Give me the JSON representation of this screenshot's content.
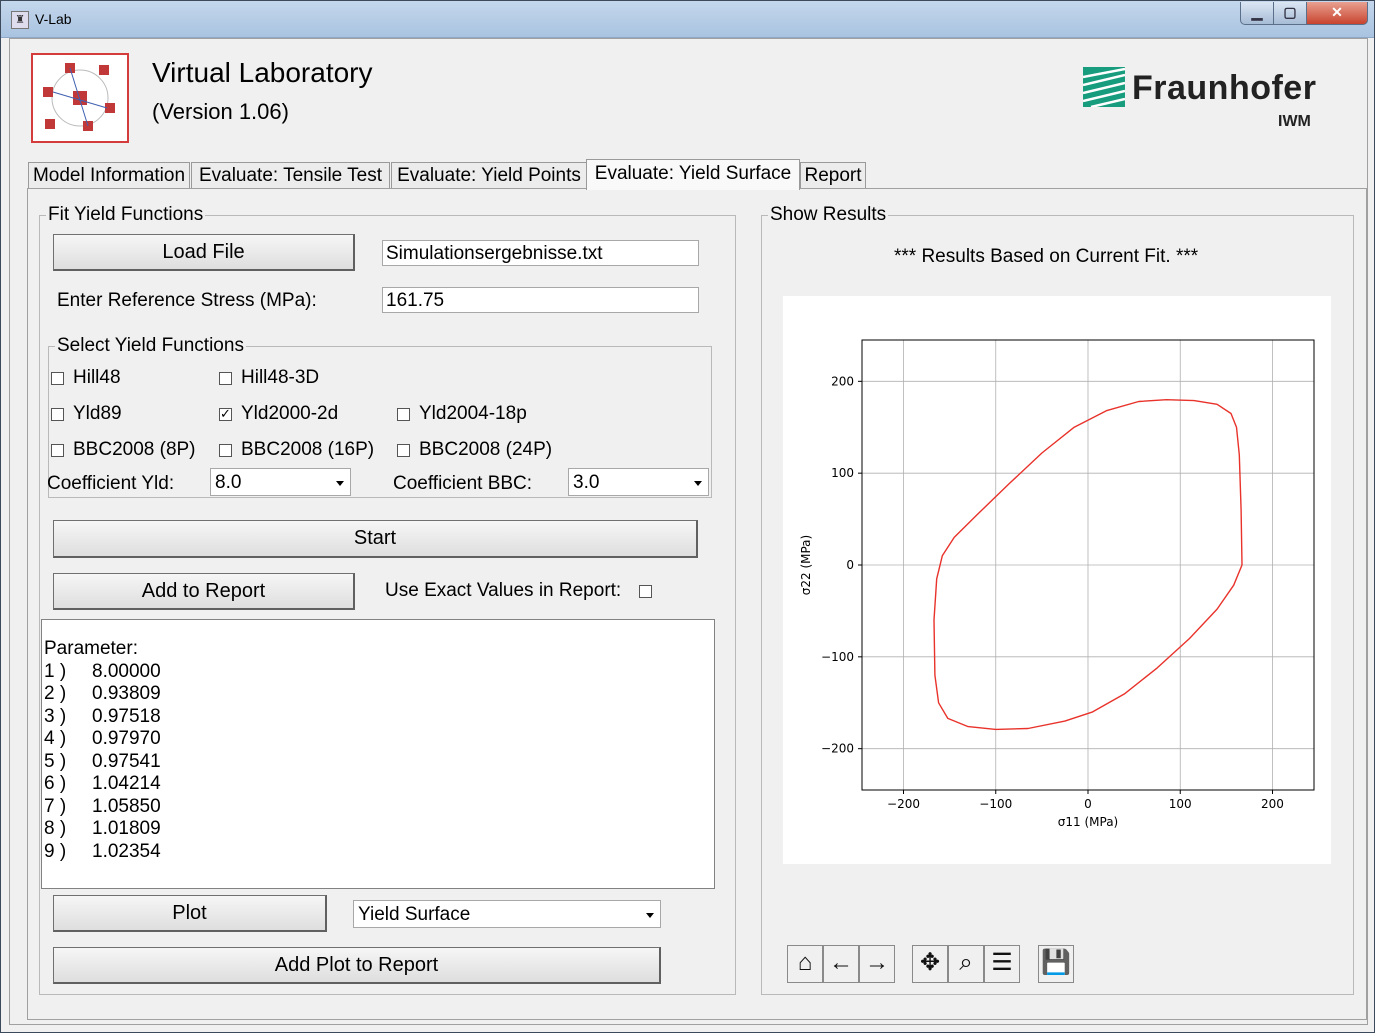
{
  "window": {
    "title": "V-Lab"
  },
  "header": {
    "app_title": "Virtual Laboratory",
    "app_version": "(Version 1.06)",
    "brand_name": "Fraunhofer",
    "brand_sub": "IWM",
    "brand_color": "#179c7d"
  },
  "tabs": [
    {
      "label": "Model Information"
    },
    {
      "label": "Evaluate: Tensile Test"
    },
    {
      "label": "Evaluate: Yield Points"
    },
    {
      "label": "Evaluate: Yield Surface"
    },
    {
      "label": "Report"
    }
  ],
  "active_tab": "Evaluate: Yield Surface",
  "fit": {
    "group_title": "Fit Yield Functions",
    "load_file_label": "Load File",
    "file_value": "Simulationsergebnisse.txt",
    "ref_stress_label": "Enter Reference Stress (MPa):",
    "ref_stress_value": "161.75",
    "select_group_title": "Select Yield Functions",
    "functions": {
      "hill48": {
        "label": "Hill48",
        "checked": false
      },
      "hill48_3d": {
        "label": "Hill48-3D",
        "checked": false
      },
      "yld89": {
        "label": "Yld89",
        "checked": false
      },
      "yld2000": {
        "label": "Yld2000-2d",
        "checked": true
      },
      "yld2004": {
        "label": "Yld2004-18p",
        "checked": false
      },
      "bbc8": {
        "label": "BBC2008 (8P)",
        "checked": false
      },
      "bbc16": {
        "label": "BBC2008 (16P)",
        "checked": false
      },
      "bbc24": {
        "label": "BBC2008 (24P)",
        "checked": false
      }
    },
    "coef_yld_label": "Coefficient Yld:",
    "coef_yld_value": "8.0",
    "coef_bbc_label": "Coefficient BBC:",
    "coef_bbc_value": "3.0",
    "start_label": "Start",
    "add_report_label": "Add to Report",
    "exact_values_label": "Use Exact Values in Report:",
    "exact_values_checked": false,
    "output_heading": "Parameter:",
    "parameters": [
      {
        "idx": "1 )",
        "value": "8.00000"
      },
      {
        "idx": "2 )",
        "value": "0.93809"
      },
      {
        "idx": "3 )",
        "value": "0.97518"
      },
      {
        "idx": "4 )",
        "value": "0.97970"
      },
      {
        "idx": "5 )",
        "value": "0.97541"
      },
      {
        "idx": "6 )",
        "value": "1.04214"
      },
      {
        "idx": "7 )",
        "value": "1.05850"
      },
      {
        "idx": "8 )",
        "value": "1.01809"
      },
      {
        "idx": "9 )",
        "value": "1.02354"
      }
    ],
    "plot_label": "Plot",
    "plot_type_value": "Yield Surface",
    "add_plot_label": "Add Plot to Report"
  },
  "results": {
    "group_title": "Show Results",
    "caption": "*** Results Based on Current Fit. ***"
  },
  "chart_data": {
    "type": "line",
    "title": "",
    "xlabel": "σ11 (MPa)",
    "ylabel": "σ22 (MPa)",
    "xlim": [
      -245,
      245
    ],
    "ylim": [
      -245,
      245
    ],
    "xticks": [
      -200,
      -100,
      0,
      100,
      200
    ],
    "yticks": [
      -200,
      -100,
      0,
      100,
      200
    ],
    "grid": true,
    "series": [
      {
        "color": "#e8322a",
        "points": [
          [
            167,
            0
          ],
          [
            166,
            60
          ],
          [
            164,
            120
          ],
          [
            161,
            150
          ],
          [
            155,
            165
          ],
          [
            140,
            175
          ],
          [
            115,
            179
          ],
          [
            85,
            180
          ],
          [
            55,
            178
          ],
          [
            20,
            168
          ],
          [
            -15,
            150
          ],
          [
            -50,
            122
          ],
          [
            -85,
            89
          ],
          [
            -120,
            55
          ],
          [
            -145,
            30
          ],
          [
            -158,
            10
          ],
          [
            -164,
            -15
          ],
          [
            -167,
            -60
          ],
          [
            -166,
            -120
          ],
          [
            -162,
            -150
          ],
          [
            -152,
            -167
          ],
          [
            -130,
            -176
          ],
          [
            -100,
            -179
          ],
          [
            -65,
            -178
          ],
          [
            -25,
            -170
          ],
          [
            5,
            -160
          ],
          [
            40,
            -140
          ],
          [
            75,
            -112
          ],
          [
            110,
            -80
          ],
          [
            140,
            -48
          ],
          [
            158,
            -22
          ],
          [
            167,
            0
          ]
        ]
      }
    ]
  },
  "toolbar_icons": [
    "home-icon",
    "back-icon",
    "forward-icon",
    "pan-icon",
    "zoom-icon",
    "configure-icon",
    "save-icon"
  ]
}
